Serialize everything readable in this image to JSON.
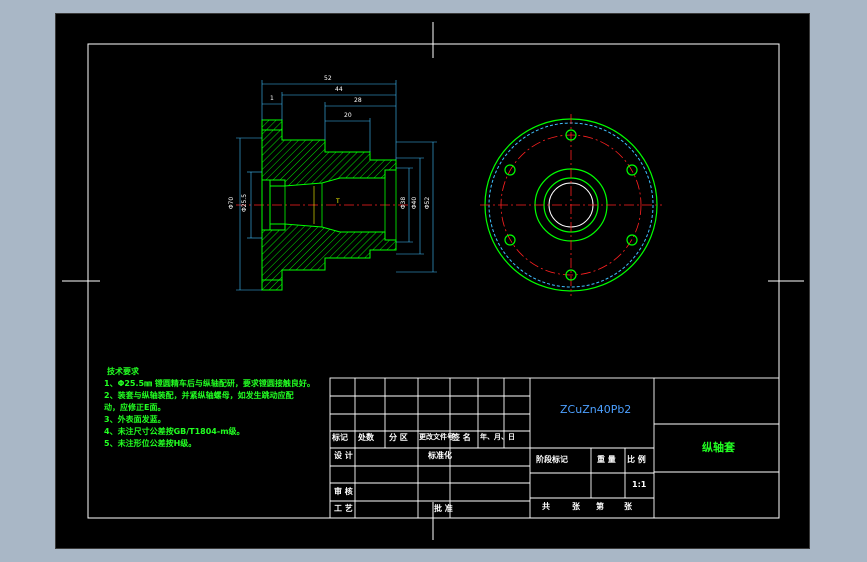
{
  "dimensions": {
    "d52": "52",
    "d44": "44",
    "d1": "1",
    "d28": "28",
    "d20": "20",
    "phi70": "Φ70",
    "phi25": "Φ25.5",
    "phi38": "Φ38",
    "phi40": "Φ40",
    "phi52": "Φ52",
    "bore": "T"
  },
  "notes": {
    "title": "技术要求",
    "lines": [
      "1、Φ25.5㎜ 镗圆精车后与纵轴配研，要求镗圆接触良好。",
      "2、装套与纵轴装配，并紧纵轴螺母，如发生跳动应配",
      "动，应修正E面。",
      "3、外表面发蓝。",
      "4、未注尺寸公差按GB/T1804-m级。",
      "5、未注形位公差按H级。"
    ]
  },
  "titleblock": {
    "material": "ZCuZn40Pb2",
    "part_name": "纵轴套",
    "mark": "标记",
    "count": "处数",
    "zone": "分 区",
    "doc": "更改文件号",
    "sign": "签 名",
    "date": "年、月、日",
    "design": "设 计",
    "standard": "标准化",
    "stage": "阶段标记",
    "weight": "重 量",
    "ratio": "比 例",
    "scale": "1:1",
    "check": "审 核",
    "process": "工 艺",
    "approve": "批 准",
    "total": "共",
    "sheets": "张",
    "page": "第",
    "sheets2": "张"
  },
  "colors": {
    "background": "#a9b7c6",
    "paper": "#000000",
    "frame": "#ffffff",
    "outline": "#00ff00",
    "hatch": "#00ff00",
    "centerline": "#ff2020",
    "dimension": "#40c0ff",
    "notes": "#22ff22",
    "material": "#4ca0ff",
    "part_name": "#22ff22"
  }
}
